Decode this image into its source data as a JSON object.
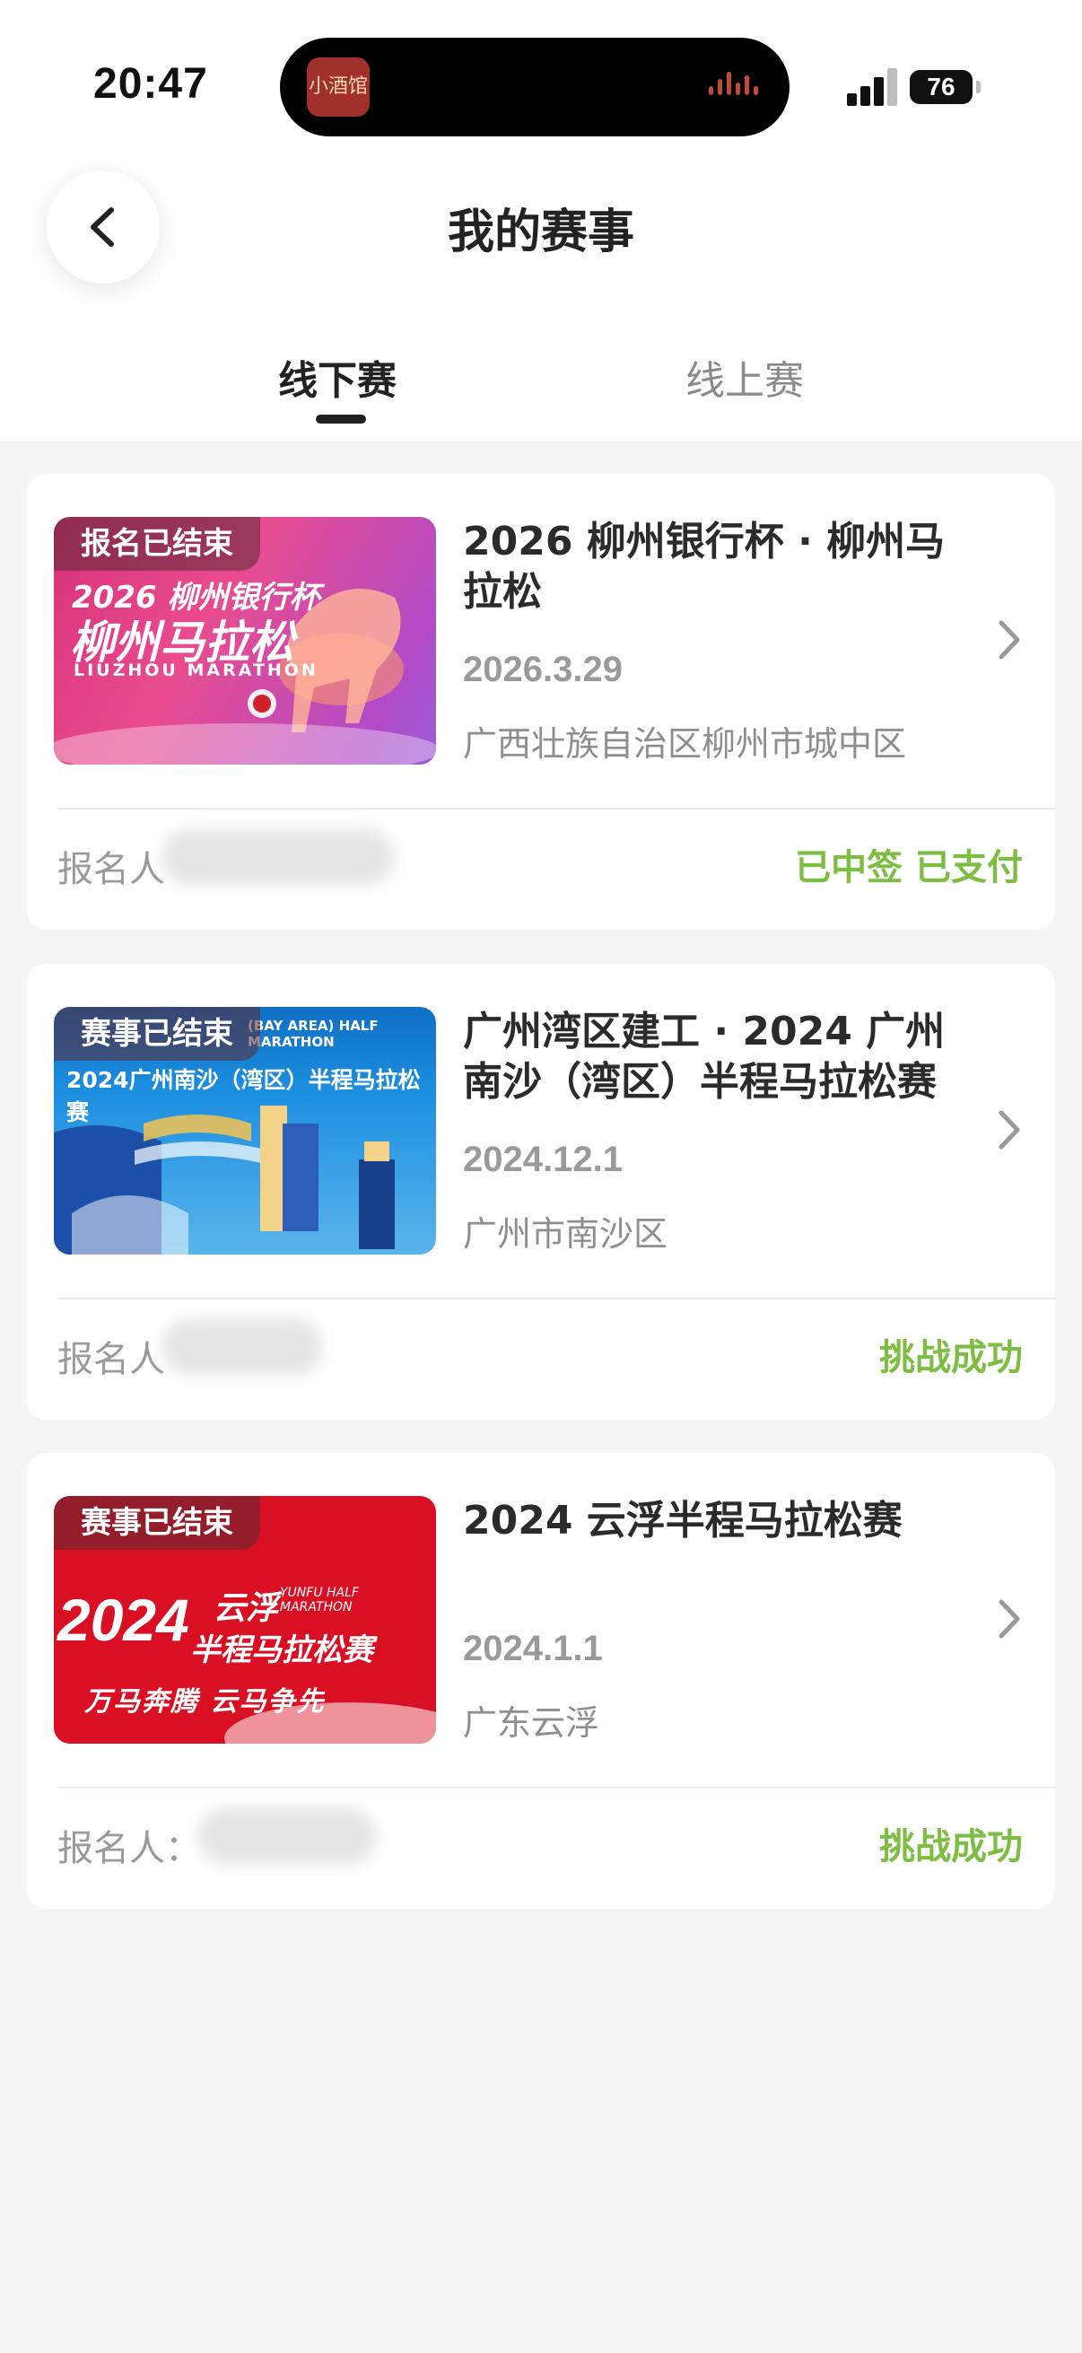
{
  "status_bar": {
    "time": "20:47",
    "battery": "76"
  },
  "island": {
    "app_icon_text": "小酒馆"
  },
  "header": {
    "title": "我的赛事"
  },
  "tabs": [
    {
      "label": "线下赛",
      "active": true
    },
    {
      "label": "线上赛",
      "active": false
    }
  ],
  "events": [
    {
      "badge": "报名已结束",
      "poster_year": "2026",
      "poster_sponsor": "柳州银行杯",
      "poster_title": "柳州马拉松",
      "poster_subtitle": "LIUZHOU MARATHON",
      "title": "2026 柳州银行杯 · 柳州马拉松",
      "date": "2026.3.29",
      "location": "广西壮族自治区柳州市城中区",
      "registrant_label": "报名人",
      "status": "已中签 已支付"
    },
    {
      "badge": "赛事已结束",
      "poster_top": "(BAY AREA) HALF MARATHON",
      "poster_title": "2024广州南沙（湾区）半程马拉松赛",
      "title": "广州湾区建工 · 2024 广州南沙（湾区）半程马拉松赛",
      "date": "2024.12.1",
      "location": "广州市南沙区",
      "registrant_label": "报名人",
      "status": "挑战成功"
    },
    {
      "badge": "赛事已结束",
      "poster_year": "2024",
      "poster_title_1": "云浮",
      "poster_en": "YUNFU HALF MARATHON",
      "poster_title_2": "半程马拉松赛",
      "poster_slogan": "万马奔腾 云马争先",
      "title": "2024 云浮半程马拉松赛",
      "date": "2024.1.1",
      "location": "广东云浮",
      "registrant_label": "报名人：",
      "status": "挑战成功"
    }
  ],
  "colors": {
    "status_green": "#7cbd42",
    "background": "#f5f5f6"
  }
}
